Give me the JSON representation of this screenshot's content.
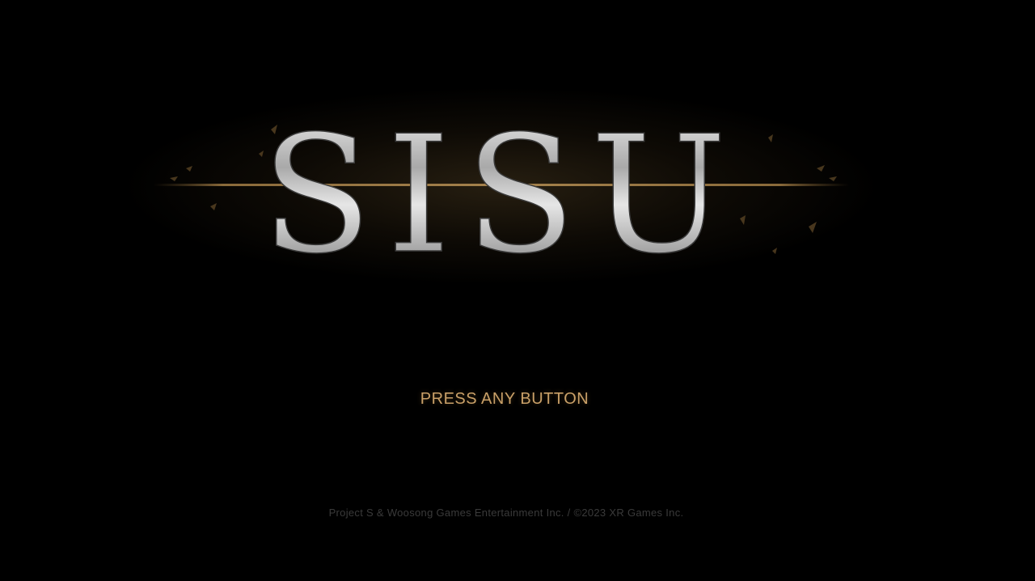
{
  "title_logo": {
    "text": "SISU",
    "icon": "sword-line-logo"
  },
  "prompt": {
    "label": "PRESS ANY BUTTON"
  },
  "footer": {
    "copyright": "Project S & Woosong Games Entertainment Inc. / ©2023 XR Games Inc."
  },
  "colors": {
    "background": "#000000",
    "accent_gold": "#c9a068",
    "logo_silver": "#c8c8c8",
    "footer_text": "#3a3a3a"
  }
}
